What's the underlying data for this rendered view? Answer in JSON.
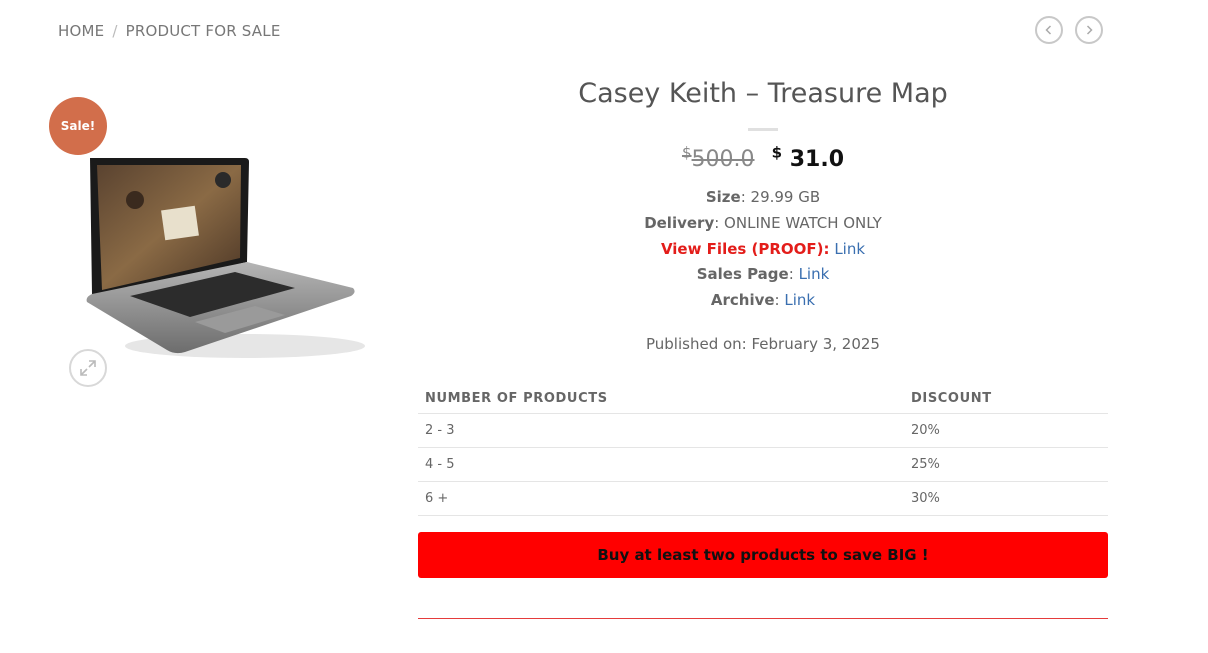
{
  "breadcrumb": {
    "home": "HOME",
    "separator": "/",
    "current": "PRODUCT FOR SALE"
  },
  "nav": {
    "prev_icon": "chevron-left-icon",
    "next_icon": "chevron-right-icon"
  },
  "badge": {
    "label": "Sale!",
    "color": "#d26e4b"
  },
  "product": {
    "title": "Casey Keith – Treasure Map",
    "currency": "$",
    "old_price": "500.0",
    "new_price": "31.0",
    "size_label": "Size",
    "size_value": ": 29.99 GB",
    "delivery_label": "Delivery",
    "delivery_value": ": ONLINE WATCH ONLY",
    "proof_label": "View Files (PROOF):",
    "proof_link": "Link",
    "sales_label": "Sales Page",
    "sales_sep": ":",
    "sales_link": "Link",
    "archive_label": "Archive",
    "archive_sep": ":",
    "archive_link": "Link",
    "published": "Published on: February 3, 2025"
  },
  "discount_table": {
    "headers": [
      "NUMBER OF PRODUCTS",
      "DISCOUNT"
    ],
    "rows": [
      [
        "2 - 3",
        "20%"
      ],
      [
        "4 - 5",
        "25%"
      ],
      [
        "6 +",
        "30%"
      ]
    ]
  },
  "cta": {
    "label": "Buy at least two products to save BIG !",
    "color": "#ff0000"
  },
  "icons": {
    "zoom": "expand-icon"
  }
}
